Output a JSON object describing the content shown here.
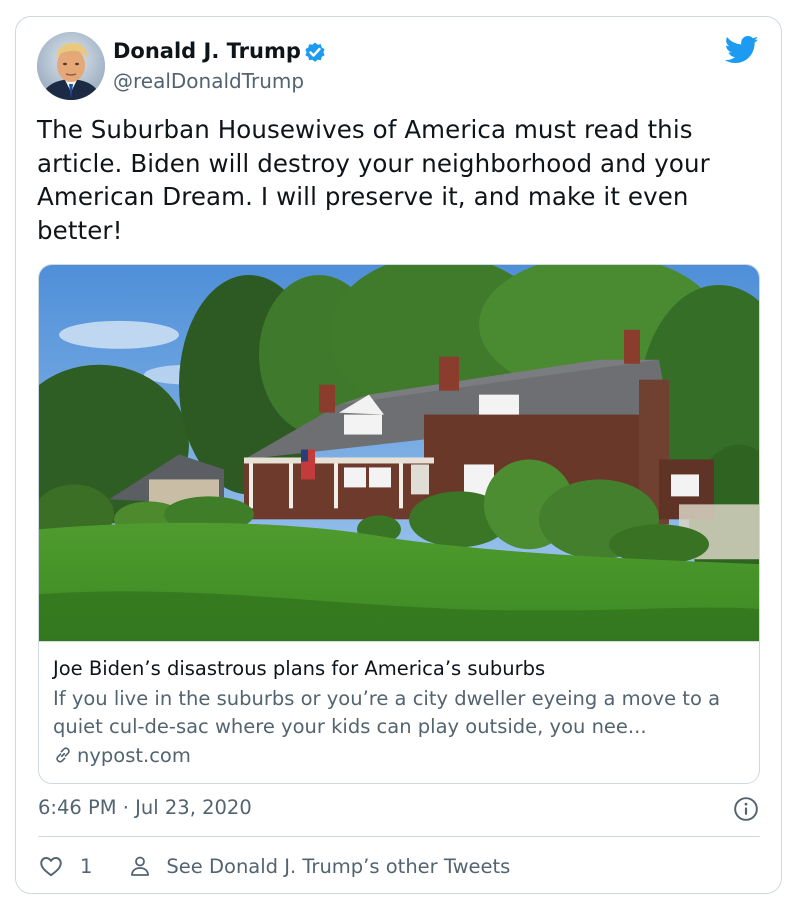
{
  "author": {
    "name": "Donald J. Trump",
    "handle": "@realDonaldTrump",
    "avatar_icon": "profile-photo",
    "verified_icon": "verified-badge-icon"
  },
  "brand": {
    "logo_icon": "twitter-bird-icon",
    "accent_color": "#1d9bf0"
  },
  "tweet": {
    "text": "The Suburban Housewives of America must read this article. Biden will destroy your neighborhood and your American Dream. I will preserve it, and make it even better!"
  },
  "link_card": {
    "image_icon": "suburban-house-photo",
    "title": "Joe Biden’s disastrous plans for America’s suburbs",
    "description": "If you live in the suburbs or you’re a city dweller eyeing a move to a quiet cul-de-sac where your kids can play outside, you nee...",
    "domain": "nypost.com",
    "domain_icon": "link-icon"
  },
  "meta": {
    "timestamp": "6:46 PM · Jul 23, 2020",
    "info_icon": "info-icon"
  },
  "actions": {
    "like_icon": "heart-icon",
    "like_count": "1",
    "profile_icon": "person-icon",
    "other_tweets_label": "See Donald J. Trump’s other Tweets"
  },
  "colors": {
    "text_primary": "#0f1419",
    "text_secondary": "#536471",
    "border": "#cfd9de"
  }
}
